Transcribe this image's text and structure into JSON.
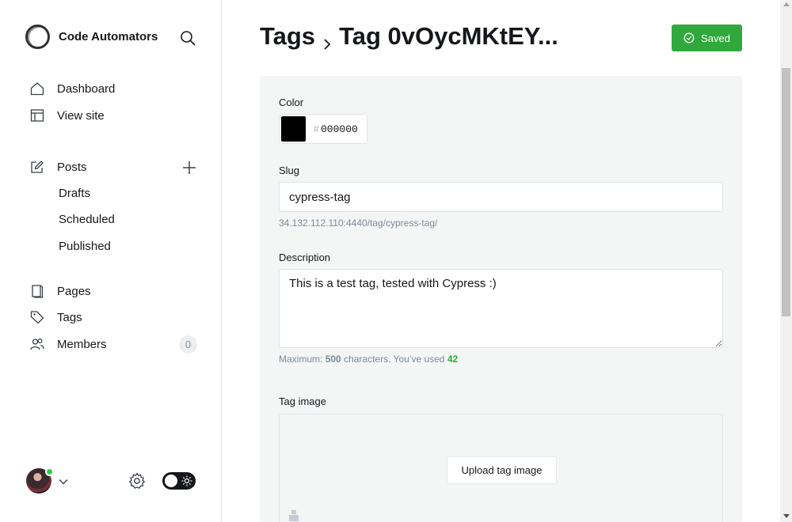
{
  "sidebar": {
    "brand": {
      "name": "Code Automators"
    },
    "nav_primary": [
      {
        "label": "Dashboard",
        "icon": "home-icon"
      },
      {
        "label": "View site",
        "icon": "layout-icon"
      }
    ],
    "posts": {
      "label": "Posts",
      "icon": "edit-icon",
      "subitems": [
        {
          "label": "Drafts"
        },
        {
          "label": "Scheduled"
        },
        {
          "label": "Published"
        }
      ]
    },
    "nav_secondary": [
      {
        "label": "Pages",
        "icon": "page-icon"
      },
      {
        "label": "Tags",
        "icon": "tag-icon"
      },
      {
        "label": "Members",
        "icon": "members-icon",
        "count": "0"
      }
    ],
    "footer": {
      "avatar_status": "online",
      "theme": "dark"
    }
  },
  "header": {
    "breadcrumb_parent": "Tags",
    "breadcrumb_current": "Tag 0vOycMKtEY...",
    "saved_label": "Saved"
  },
  "form": {
    "color": {
      "label": "Color",
      "hash": "#",
      "value": "000000",
      "swatch": "#000000"
    },
    "slug": {
      "label": "Slug",
      "value": "cypress-tag",
      "url_hint": "34.132.112.110:4440/tag/cypress-tag/"
    },
    "description": {
      "label": "Description",
      "value": "This is a test tag, tested with Cypress :)",
      "hint_prefix": "Maximum:",
      "max": "500",
      "hint_middle": "characters. You’ve used",
      "used": "42"
    },
    "tag_image": {
      "label": "Tag image",
      "upload_label": "Upload tag image"
    }
  },
  "colors": {
    "accent_green": "#30a83b",
    "online_dot": "#30cf43"
  }
}
